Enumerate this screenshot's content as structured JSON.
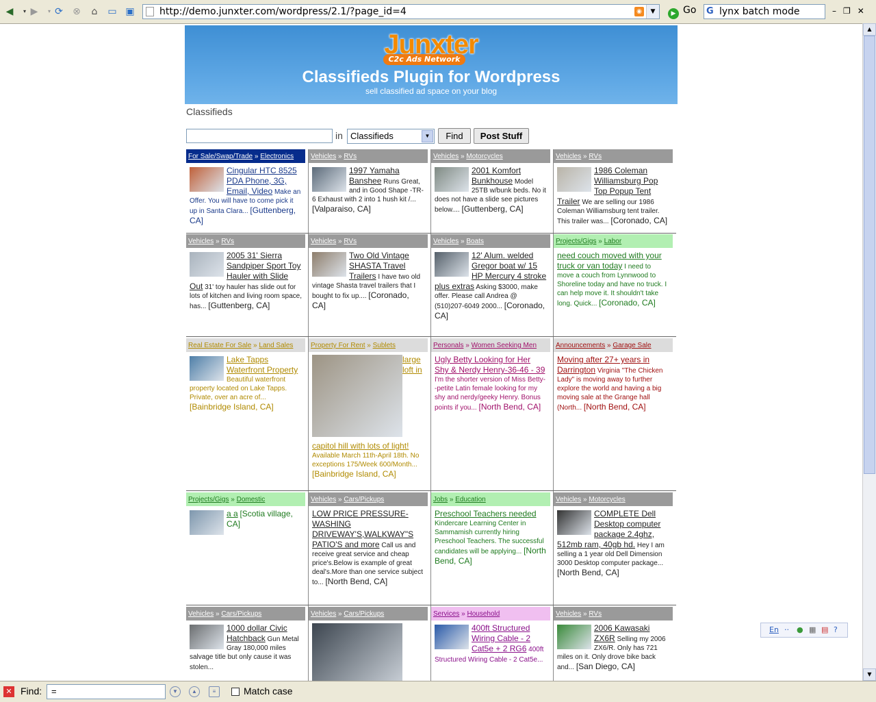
{
  "browser": {
    "url": "http://demo.junxter.com/wordpress/2.1/?page_id=4",
    "go_label": "Go",
    "search_value": "lynx batch mode",
    "search_engine_glyph": "G"
  },
  "banner": {
    "logo": "Junxter",
    "logo_sub": "C2c Ads Network",
    "title": "Classifieds Plugin for Wordpress",
    "tagline": "sell classified ad space on your blog"
  },
  "page_title": "Classifieds",
  "search": {
    "query": "",
    "in_label": "in",
    "category": "Classifieds",
    "find_label": "Find",
    "post_label": "Post Stuff"
  },
  "listings": [
    {
      "cat": "For Sale/Swap/Trade",
      "sub": "Electronics",
      "title": "Cingular HTC 8525 PDA Phone, 3G, Email, Video",
      "desc": "Make an Offer. You will have to come pick it up in Santa Clara...",
      "loc": "[Guttenberg, CA]",
      "hdr_bg": "#062c8c",
      "hdr_fg": "#ffffff",
      "text": "#1a3a8a",
      "thumb": "#c0613a"
    },
    {
      "cat": "Vehicles",
      "sub": "RVs",
      "title": "1997 Yamaha Banshee",
      "desc": "Runs Great, and in Good Shape -TR-6 Exhaust with 2 into 1 hush kit /...",
      "loc": "[Valparaiso, CA]",
      "hdr_bg": "#9a9a9a",
      "hdr_fg": "#ffffff",
      "text": "#222222",
      "thumb": "#5c6b7a"
    },
    {
      "cat": "Vehicles",
      "sub": "Motorcycles",
      "title": "2001 Komfort Bunkhouse",
      "desc": "Model 25TB w/bunk beds. No it does not have a slide see pictures below....",
      "loc": "[Guttenberg, CA]",
      "hdr_bg": "#9a9a9a",
      "hdr_fg": "#ffffff",
      "text": "#222222",
      "thumb": "#7f8a83"
    },
    {
      "cat": "Vehicles",
      "sub": "RVs",
      "title": "1986 Coleman Williamsburg Pop Top Popup Tent Trailer",
      "desc": "We are selling our 1986 Coleman Williamsburg tent trailer. This trailer was...",
      "loc": "[Coronado, CA]",
      "hdr_bg": "#9a9a9a",
      "hdr_fg": "#ffffff",
      "text": "#222222",
      "thumb": "#b9b4a8"
    },
    {
      "cat": "Vehicles",
      "sub": "RVs",
      "title": "2005 31' Sierra Sandpiper Sport Toy Hauler with Slide Out",
      "desc": "31' toy hauler has slide out for lots of kitchen and living room space, has...",
      "loc": "[Guttenberg, CA]",
      "hdr_bg": "#9a9a9a",
      "hdr_fg": "#ffffff",
      "text": "#222222",
      "thumb": "#a9b3bd"
    },
    {
      "cat": "Vehicles",
      "sub": "RVs",
      "title": "Two Old Vintage SHASTA Travel Trailers",
      "desc": "I have two old vintage Shasta travel trailers that I bought to fix up....",
      "loc": "[Coronado, CA]",
      "hdr_bg": "#9a9a9a",
      "hdr_fg": "#ffffff",
      "text": "#222222",
      "thumb": "#8e7e6c"
    },
    {
      "cat": "Vehicles",
      "sub": "Boats",
      "title": "12' Alum. welded Gregor boat w/ 15 HP Mercury 4 stroke plus extras",
      "desc": "Asking $3000, make offer. Please call Andrea @ (510)207-6049 2000...",
      "loc": "[Coronado, CA]",
      "hdr_bg": "#9a9a9a",
      "hdr_fg": "#ffffff",
      "text": "#222222",
      "thumb": "#55606a"
    },
    {
      "cat": "Projects/Gigs",
      "sub": "Labor",
      "title": "need couch moved with your truck or van today",
      "desc": "I need to move a couch from Lynnwood to Shoreline today and have no truck. I can help move it. It shouldn't take long. Quick...",
      "loc": "[Coronado, CA]",
      "hdr_bg": "#b2efb2",
      "hdr_fg": "#1e7a1e",
      "text": "#1e7a1e",
      "thumb": ""
    },
    {
      "cat": "Real Estate For Sale",
      "sub": "Land Sales",
      "title": "Lake Tapps Waterfront Property",
      "desc": "Beautiful waterfront property located on Lake Tapps. Private, over an acre of...",
      "loc": "[Bainbridge Island, CA]",
      "hdr_bg": "#dcdcdc",
      "hdr_fg": "#b08a00",
      "text": "#b08a00",
      "thumb": "#4f7fa8"
    },
    {
      "cat": "Property For Rent",
      "sub": "Sublets",
      "title": "large loft in capitol hill with lots of light!",
      "desc": "Available March 11th-April 18th. No exceptions 175/Week 600/Month...",
      "loc": "[Bainbridge Island, CA]",
      "hdr_bg": "#dcdcdc",
      "hdr_fg": "#b08a00",
      "text": "#b08a00",
      "thumb": "#9d9484"
    },
    {
      "cat": "Personals",
      "sub": "Women Seeking Men",
      "title": "Ugly Betty Looking for Her Shy & Nerdy Henry-36-46 - 39",
      "desc": "I'm the shorter version of Miss Betty--petite Latin female looking for my shy and nerdy/geeky Henry. Bonus points if you...",
      "loc": "[North Bend, CA]",
      "hdr_bg": "#dcdcdc",
      "hdr_fg": "#a0106a",
      "text": "#a0106a",
      "thumb": ""
    },
    {
      "cat": "Announcements",
      "sub": "Garage Sale",
      "title": "Moving after 27+ years in Darrington",
      "desc": "Virginia \"The Chicken Lady\" is moving away to further explore the world and having a big moving sale at the Grange hall (North...",
      "loc": "[North Bend, CA]",
      "hdr_bg": "#dcdcdc",
      "hdr_fg": "#a01010",
      "text": "#a01010",
      "thumb": ""
    },
    {
      "cat": "Projects/Gigs",
      "sub": "Domestic",
      "title": "a a",
      "desc": "",
      "loc": "[Scotia village, CA]",
      "hdr_bg": "#b2efb2",
      "hdr_fg": "#1e7a1e",
      "text": "#1e7a1e",
      "thumb": "#7e97ad"
    },
    {
      "cat": "Vehicles",
      "sub": "Cars/Pickups",
      "title": "LOW PRICE PRESSURE-WASHING DRIVEWAY'S,WALKWAY\"S PATIO'S and more",
      "desc": "Call us and receive great service and cheap price's.Below is example of great deal's.More than one service subject to...",
      "loc": "[North Bend, CA]",
      "hdr_bg": "#9a9a9a",
      "hdr_fg": "#ffffff",
      "text": "#222222",
      "thumb": ""
    },
    {
      "cat": "Jobs",
      "sub": "Education",
      "title": "Preschool Teachers needed",
      "desc": "Kindercare Learning Center in Sammamish currently hiring Preschool Teachers. The successful candidates will be applying...",
      "loc": "[North Bend, CA]",
      "hdr_bg": "#b2efb2",
      "hdr_fg": "#1e7a1e",
      "text": "#1e7a1e",
      "thumb": ""
    },
    {
      "cat": "Vehicles",
      "sub": "Motorcycles",
      "title": "COMPLETE Dell Desktop computer package 2.4ghz, 512mb ram, 40gb hd.",
      "desc": "Hey I am selling a 1 year old Dell Dimension 3000 Desktop computer package...",
      "loc": "[North Bend, CA]",
      "hdr_bg": "#9a9a9a",
      "hdr_fg": "#ffffff",
      "text": "#222222",
      "thumb": "#333333"
    },
    {
      "cat": "Vehicles",
      "sub": "Cars/Pickups",
      "title": "1000 dollar Civic Hatchback",
      "desc": "Gun Metal Gray 180,000 miles salvage title but only cause it was stolen...",
      "loc": "",
      "hdr_bg": "#9a9a9a",
      "hdr_fg": "#ffffff",
      "text": "#222222",
      "thumb": "#6b6e70"
    },
    {
      "cat": "Vehicles",
      "sub": "Cars/Pickups",
      "title": "",
      "desc": "",
      "loc": "",
      "hdr_bg": "#9a9a9a",
      "hdr_fg": "#ffffff",
      "text": "#222222",
      "thumb": "#3d4650"
    },
    {
      "cat": "Services",
      "sub": "Household",
      "title": "400ft Structured Wiring Cable - 2 Cat5e + 2 RG6",
      "desc": "400ft Structured Wiring Cable - 2 Cat5e...",
      "loc": "",
      "hdr_bg": "#f0bff0",
      "hdr_fg": "#8a108a",
      "text": "#8a108a",
      "thumb": "#2a5aa8"
    },
    {
      "cat": "Vehicles",
      "sub": "RVs",
      "title": "2006 Kawasaki ZX6R",
      "desc": "Selling my 2006 ZX6/R. Only has 721 miles on it. Only drove bike back and...",
      "loc": "[San Diego, CA]",
      "hdr_bg": "#9a9a9a",
      "hdr_fg": "#ffffff",
      "text": "#222222",
      "thumb": "#3a8a3a"
    }
  ],
  "findbar": {
    "label": "Find:",
    "value": "=",
    "match_case_label": "Match case",
    "match_case_checked": false
  },
  "langbar": {
    "lang": "En"
  }
}
